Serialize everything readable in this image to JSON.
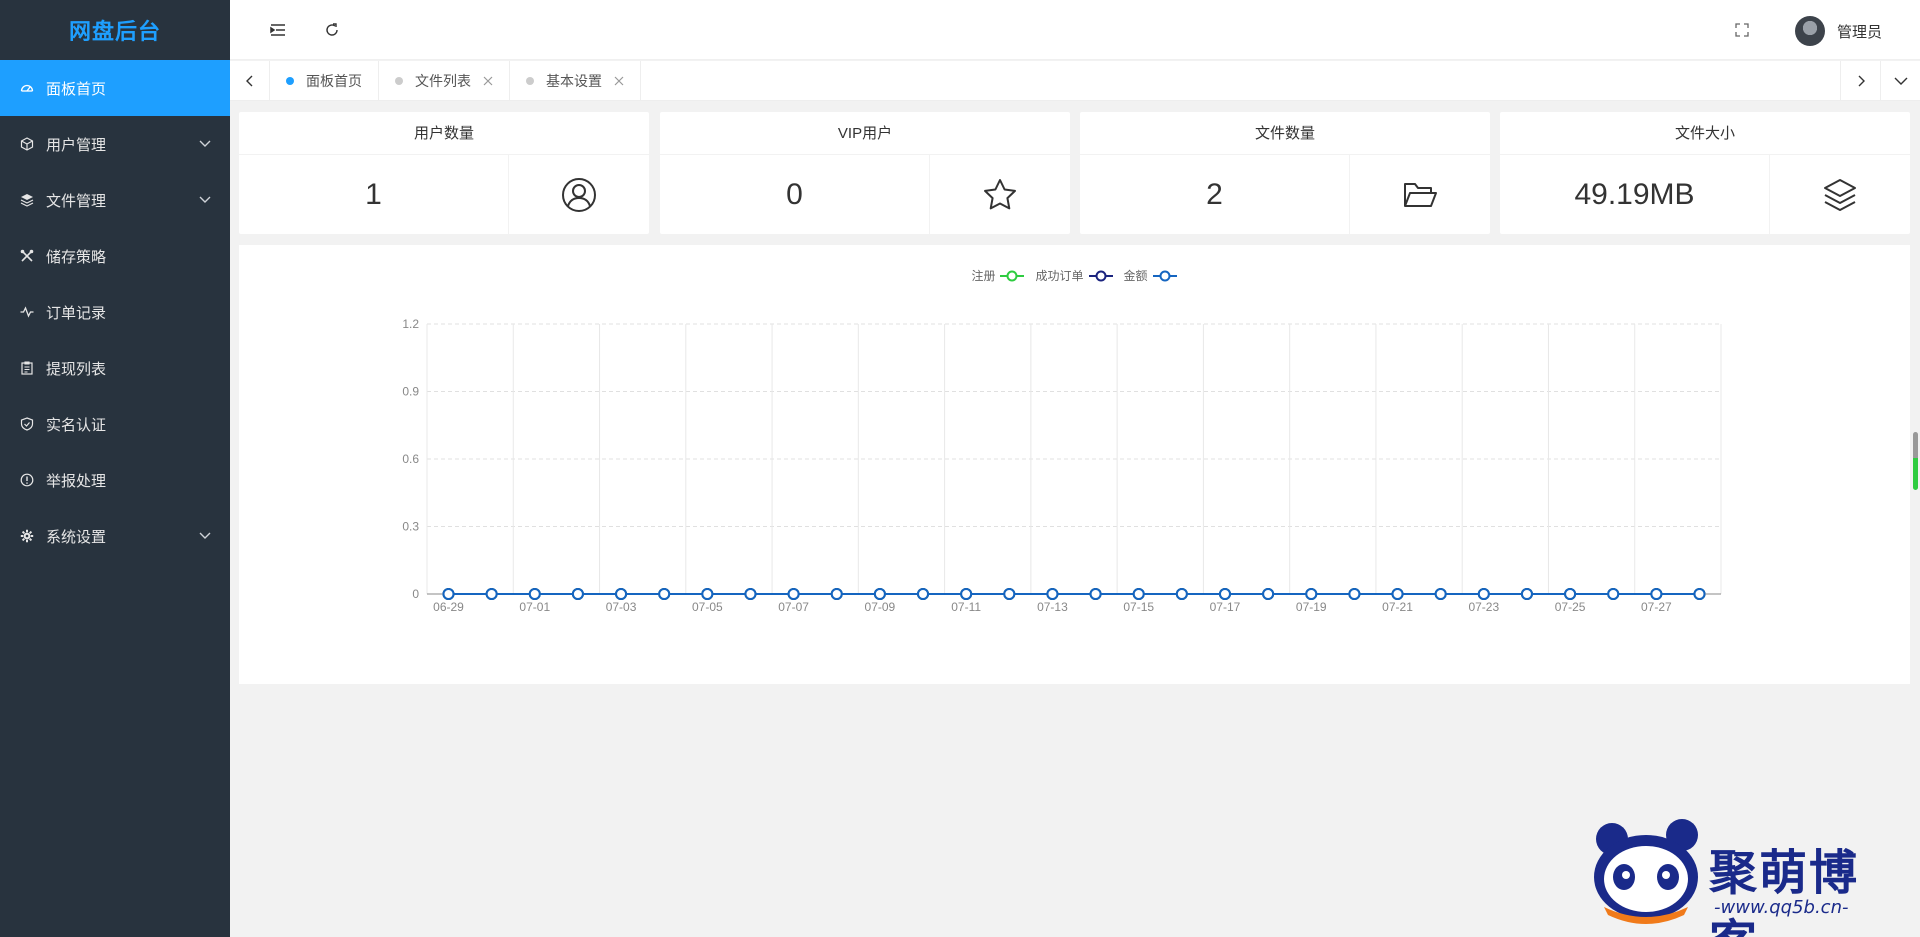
{
  "brand": "网盘后台",
  "sidebar": {
    "items": [
      {
        "label": "面板首页",
        "icon": "dashboard-icon",
        "active": true,
        "expandable": false
      },
      {
        "label": "用户管理",
        "icon": "cube-icon",
        "active": false,
        "expandable": true
      },
      {
        "label": "文件管理",
        "icon": "layers-icon",
        "active": false,
        "expandable": true
      },
      {
        "label": "储存策略",
        "icon": "tools-icon",
        "active": false,
        "expandable": false
      },
      {
        "label": "订单记录",
        "icon": "pulse-icon",
        "active": false,
        "expandable": false
      },
      {
        "label": "提现列表",
        "icon": "clipboard-icon",
        "active": false,
        "expandable": false
      },
      {
        "label": "实名认证",
        "icon": "shield-icon",
        "active": false,
        "expandable": false
      },
      {
        "label": "举报处理",
        "icon": "info-icon",
        "active": false,
        "expandable": false
      },
      {
        "label": "系统设置",
        "icon": "gear-icon",
        "active": false,
        "expandable": true
      }
    ]
  },
  "header": {
    "user_name": "管理员"
  },
  "tabs": [
    {
      "label": "面板首页",
      "active": true,
      "closable": false
    },
    {
      "label": "文件列表",
      "active": false,
      "closable": true
    },
    {
      "label": "基本设置",
      "active": false,
      "closable": true
    }
  ],
  "cards": [
    {
      "title": "用户数量",
      "value": "1",
      "icon": "user-circle-icon"
    },
    {
      "title": "VIP用户",
      "value": "0",
      "icon": "star-icon"
    },
    {
      "title": "文件数量",
      "value": "2",
      "icon": "folder-open-icon"
    },
    {
      "title": "文件大小",
      "value": "49.19MB",
      "icon": "layers-icon"
    }
  ],
  "chart_data": {
    "type": "line",
    "x": [
      "06-29",
      "06-30",
      "07-01",
      "07-02",
      "07-03",
      "07-04",
      "07-05",
      "07-06",
      "07-07",
      "07-08",
      "07-09",
      "07-10",
      "07-11",
      "07-12",
      "07-13",
      "07-14",
      "07-15",
      "07-16",
      "07-17",
      "07-18",
      "07-19",
      "07-20",
      "07-21",
      "07-22",
      "07-23",
      "07-24",
      "07-25",
      "07-26",
      "07-27",
      "07-28"
    ],
    "x_tick_labels": [
      "06-29",
      "07-01",
      "07-03",
      "07-05",
      "07-07",
      "07-09",
      "07-11",
      "07-13",
      "07-15",
      "07-17",
      "07-19",
      "07-21",
      "07-23",
      "07-25",
      "07-27"
    ],
    "y_ticks": [
      0,
      0.3,
      0.6,
      0.9,
      1.2
    ],
    "ylim": [
      0,
      1.2
    ],
    "grid": true,
    "legend_position": "top-center",
    "series": [
      {
        "name": "注册",
        "color": "#2ecc40",
        "values": [
          0,
          0,
          0,
          0,
          0,
          0,
          0,
          0,
          0,
          0,
          0,
          0,
          0,
          0,
          0,
          0,
          0,
          0,
          0,
          0,
          0,
          0,
          0,
          0,
          0,
          0,
          0,
          0,
          0,
          0
        ]
      },
      {
        "name": "成功订单",
        "color": "#1a237e",
        "values": [
          0,
          0,
          0,
          0,
          0,
          0,
          0,
          0,
          0,
          0,
          0,
          0,
          0,
          0,
          0,
          0,
          0,
          0,
          0,
          0,
          0,
          0,
          0,
          0,
          0,
          0,
          0,
          0,
          0,
          0
        ]
      },
      {
        "name": "金额",
        "color": "#1565c0",
        "values": [
          0,
          0,
          0,
          0,
          0,
          0,
          0,
          0,
          0,
          0,
          0,
          0,
          0,
          0,
          0,
          0,
          0,
          0,
          0,
          0,
          0,
          0,
          0,
          0,
          0,
          0,
          0,
          0,
          0,
          0
        ]
      }
    ]
  },
  "watermark": {
    "title": "聚萌博客",
    "url": "-www.qq5b.cn-"
  }
}
